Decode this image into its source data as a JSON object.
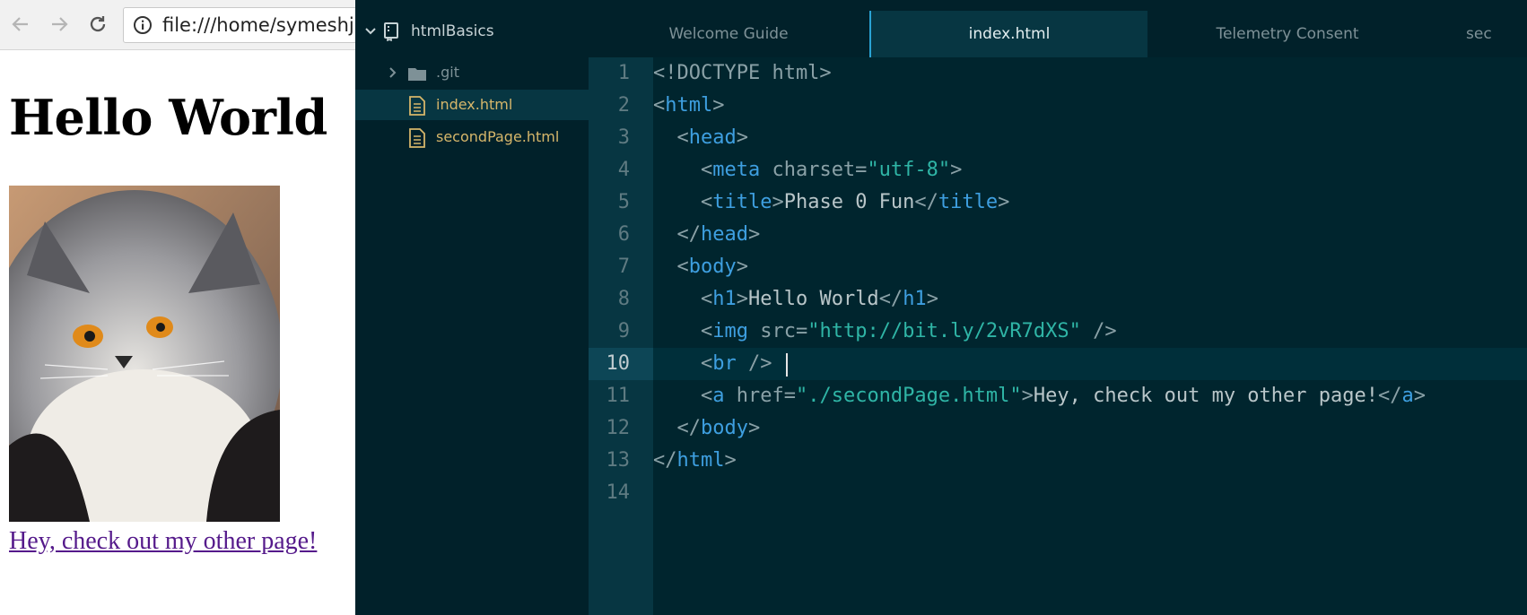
{
  "browser": {
    "url": "file:///home/symeshjb/",
    "page": {
      "heading": "Hello World",
      "image_alt": "fluffy-cat-photo",
      "link_text": "Hey, check out my other page!"
    }
  },
  "editor": {
    "project": "htmlBasics",
    "tree": [
      {
        "label": ".git",
        "type": "folder",
        "color": "#7e9197"
      },
      {
        "label": "index.html",
        "type": "file",
        "color": "#d6b66a",
        "selected": true
      },
      {
        "label": "secondPage.html",
        "type": "file",
        "color": "#d6b66a"
      }
    ],
    "tabs": [
      {
        "label": "Welcome Guide",
        "active": false
      },
      {
        "label": "index.html",
        "active": true
      },
      {
        "label": "Telemetry Consent",
        "active": false
      },
      {
        "label": "sec",
        "active": false
      }
    ],
    "active_line": 10,
    "line_numbers": [
      "1",
      "2",
      "3",
      "4",
      "5",
      "6",
      "7",
      "8",
      "9",
      "10",
      "11",
      "12",
      "13",
      "14"
    ],
    "code": {
      "l1": {
        "a": "<!DOCTYPE html>"
      },
      "l2": {
        "a": "<",
        "b": "html",
        "c": ">"
      },
      "l3": {
        "indent": "  ",
        "a": "<",
        "b": "head",
        "c": ">"
      },
      "l4": {
        "indent": "    ",
        "a": "<",
        "b": "meta",
        "c": " charset=",
        "d": "\"utf-8\"",
        "e": ">"
      },
      "l5": {
        "indent": "    ",
        "a": "<",
        "b": "title",
        "c": ">",
        "d": "Phase 0 Fun",
        "e": "</",
        "f": "title",
        "g": ">"
      },
      "l6": {
        "indent": "  ",
        "a": "</",
        "b": "head",
        "c": ">"
      },
      "l7": {
        "indent": "  ",
        "a": "<",
        "b": "body",
        "c": ">"
      },
      "l8": {
        "indent": "    ",
        "a": "<",
        "b": "h1",
        "c": ">",
        "d": "Hello World",
        "e": "</",
        "f": "h1",
        "g": ">"
      },
      "l9": {
        "indent": "    ",
        "a": "<",
        "b": "img",
        "c": " src=",
        "d": "\"http://bit.ly/2vR7dXS\"",
        "e": " />"
      },
      "l10": {
        "indent": "    ",
        "a": "<",
        "b": "br",
        "c": " />"
      },
      "l11": {
        "indent": "    ",
        "a": "<",
        "b": "a",
        "c": " href=",
        "d": "\"./secondPage.html\"",
        "e": ">",
        "f": "Hey, check out my other page!",
        "g": "</",
        "h": "a",
        "i": ">"
      },
      "l12": {
        "indent": "  ",
        "a": "</",
        "b": "body",
        "c": ">"
      },
      "l13": {
        "a": "</",
        "b": "html",
        "c": ">"
      }
    }
  },
  "colors": {
    "editor_bg": "#00252e",
    "tag": "#3e9fe0",
    "string": "#2fb5a6",
    "link_visited": "#551a8b",
    "active_tab_border": "#2aa3d4"
  }
}
